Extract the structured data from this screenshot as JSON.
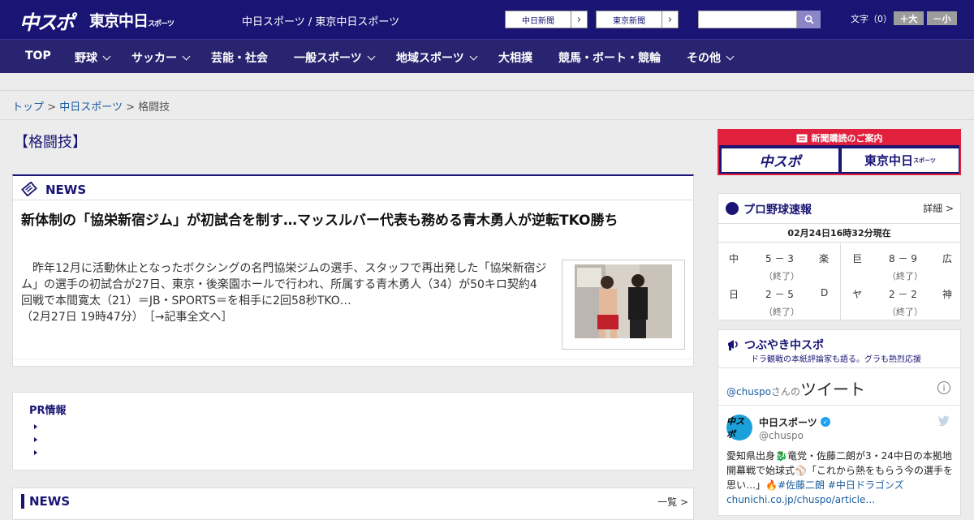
{
  "header": {
    "logo_chuspo": "中スポ",
    "logo_tokyo": "東京中日",
    "logo_tokyo_small": "スポーツ",
    "site_title": "中日スポーツ / 東京中日スポーツ",
    "buttons": [
      {
        "label": "中日新聞"
      },
      {
        "label": "東京新聞"
      }
    ],
    "search": {
      "placeholder": "",
      "value": ""
    },
    "font_size_label": "文字（0）",
    "font_larger": "＋大",
    "font_smaller": "－小"
  },
  "nav": {
    "items": [
      {
        "label": "TOP"
      },
      {
        "label": "野球"
      },
      {
        "label": "サッカー"
      },
      {
        "label": "芸能・社会"
      },
      {
        "label": "一般スポーツ"
      },
      {
        "label": "地域スポーツ"
      },
      {
        "label": "大相撲"
      },
      {
        "label": "競馬・ボート・競輪"
      },
      {
        "label": "その他"
      }
    ]
  },
  "breadcrumb": {
    "items": [
      "トップ",
      "中日スポーツ",
      "格闘技"
    ],
    "separator": ">"
  },
  "category_title": "【格闘技】",
  "news": {
    "label": "NEWS",
    "headline": "新体制の「協栄新宿ジム」が初試合を制す…マッスルバー代表も務める青木勇人が逆転TKO勝ち",
    "summary": "昨年12月に活動休止となったボクシングの名門協栄ジムの選手、スタッフで再出発した「協栄新宿ジム」の選手の初試合が27日、東京・後楽園ホールで行われ、所属する青木勇人（34）が50キロ契約4回戦で本間寛太（21）＝JB・SPORTS＝を相手に2回58秒TKO…",
    "datetime": "（2月27日 19時47分）",
    "read_more": "［→記事全文へ］"
  },
  "pr": {
    "label": "PR情報",
    "items": [
      "",
      "",
      ""
    ]
  },
  "news_list": {
    "label": "NEWS",
    "more": "一覧 >"
  },
  "sidebar": {
    "subscribe": {
      "title": "新聞購読のご案内",
      "logo1": "中スポ",
      "logo2": "東京中日",
      "logo2_small": "スポーツ"
    },
    "baseball": {
      "title": "プロ野球速報",
      "detail": "詳細 >",
      "time": "02月24日16時32分現在",
      "games": [
        {
          "home": "中",
          "score": "5 － 3",
          "away": "楽",
          "status": "（終了）"
        },
        {
          "home": "巨",
          "score": "8 － 9",
          "away": "広",
          "status": "（終了）"
        },
        {
          "home": "日",
          "score": "2 － 5",
          "away": "D",
          "status": "（終了）"
        },
        {
          "home": "ヤ",
          "score": "2 － 2",
          "away": "神",
          "status": "（終了）"
        }
      ]
    },
    "tweets": {
      "title": "つぶやき中スポ",
      "subtitle": "ドラ観戦の本紙評論家も語る。グラも熱烈応援",
      "handle_link": "@chuspo",
      "handle_suffix": "さんの",
      "heading": "ツイート",
      "info": "i",
      "avatar_text": "中スポ",
      "name": "中日スポーツ",
      "handle": "@chuspo",
      "text_1": "愛知県出身🐉竜党・佐藤二朗が3・24中日の本拠地開幕戦で始球式⚾「これから熱をもらう今の選手を思い…」🔥",
      "tag_1": "#佐藤二朗",
      "tag_2": "#中日ドラゴンズ",
      "link": "chunichi.co.jp/chuspo/article…"
    }
  },
  "colors": {
    "brand": "#1a1574",
    "nav": "#29246f",
    "accent_red": "#e0203c",
    "link": "#1a5c9e",
    "search_button": "#8b86c7"
  }
}
